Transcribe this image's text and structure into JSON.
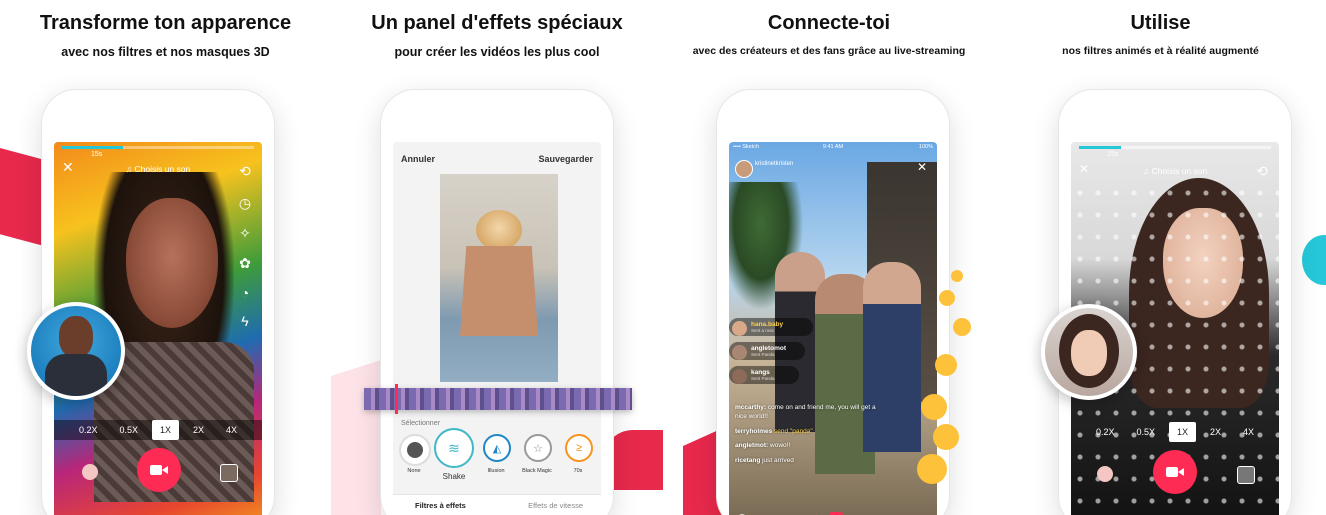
{
  "panels": [
    {
      "title": "Transforme ton apparence",
      "subtitle": "avec nos filtres et nos masques 3D",
      "screen": {
        "timer": "15s",
        "sound": "♫ Choisis un son",
        "speeds": [
          "0.2X",
          "0.5X",
          "1X",
          "2X",
          "4X"
        ],
        "selected_speed": "1X"
      }
    },
    {
      "title": "Un panel d'effets spéciaux",
      "subtitle": "pour créer les vidéos les plus cool",
      "screen": {
        "cancel": "Annuler",
        "save": "Sauvegarder",
        "select_label": "Sélectionner",
        "effects": [
          "None",
          "Shake",
          "Illusion",
          "Black Magic",
          "70s"
        ],
        "tabs": [
          "Filtres à effets",
          "Effets de vitesse"
        ]
      }
    },
    {
      "title": "Connecte-toi",
      "subtitle": "avec des créateurs et des fans grâce au live-streaming",
      "screen": {
        "status_left": "•••• Sketch",
        "status_time": "9:41 AM",
        "status_right": "100%",
        "host": "kristinetkristen",
        "viewers": [
          {
            "name": "hana.baby",
            "sub": "Sent a rose"
          },
          {
            "name": "angletomot",
            "sub": "Sent Panda"
          },
          {
            "name": "kangs",
            "sub": "Sent Panda"
          }
        ],
        "comments": [
          {
            "user": "mccarthy:",
            "text": "come on and friend me, you will get a nice world!!"
          },
          {
            "user": "terryholmes",
            "text": "send \"panda\""
          },
          {
            "user": "angletmot:",
            "text": "wowo!!"
          },
          {
            "user": "ricetang",
            "text": "just arrived"
          }
        ]
      }
    },
    {
      "title": "Utilise",
      "subtitle": "nos filtres animés et à réalité augmenté",
      "screen": {
        "timer": "15s",
        "sound": "♫ Choisis un son",
        "speeds": [
          "0.2X",
          "0.5X",
          "1X",
          "2X",
          "4X"
        ],
        "selected_speed": "1X"
      }
    }
  ],
  "colors": {
    "brand_red": "#fe2c55",
    "brand_cyan": "#25c7d9",
    "effect_orange": "#f7931e",
    "effect_teal": "#3cb8c7"
  }
}
